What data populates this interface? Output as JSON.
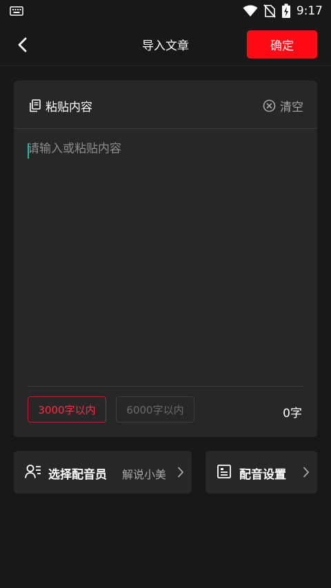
{
  "status_bar": {
    "time": "9:17",
    "icons": [
      "keyboard-icon",
      "wifi-icon",
      "no-sim-icon",
      "battery-charging-icon"
    ]
  },
  "header": {
    "back_icon": "chevron-left-icon",
    "title": "导入文章",
    "confirm_label": "确定"
  },
  "editor": {
    "paste_icon": "copy-icon",
    "paste_label": "粘贴内容",
    "clear_icon": "circle-x-icon",
    "clear_label": "清空",
    "placeholder": "请输入或粘贴内容",
    "value": "",
    "limits": [
      "3000字以内",
      "6000字以内"
    ],
    "selected_limit": "3000字以内",
    "char_count": "0字"
  },
  "options": {
    "voice": {
      "icon": "user-list-icon",
      "label": "选择配音员",
      "value": "解说小美",
      "chevron": "chevron-right-icon"
    },
    "settings": {
      "icon": "document-list-icon",
      "label": "配音设置",
      "chevron": "chevron-right-icon"
    }
  },
  "colors": {
    "background": "#181819",
    "card": "#272728",
    "accent": "#ff0b16",
    "selected_limit": "#ff2b42",
    "muted_text": "#a8a8aa",
    "caret": "#1fbf9f"
  }
}
